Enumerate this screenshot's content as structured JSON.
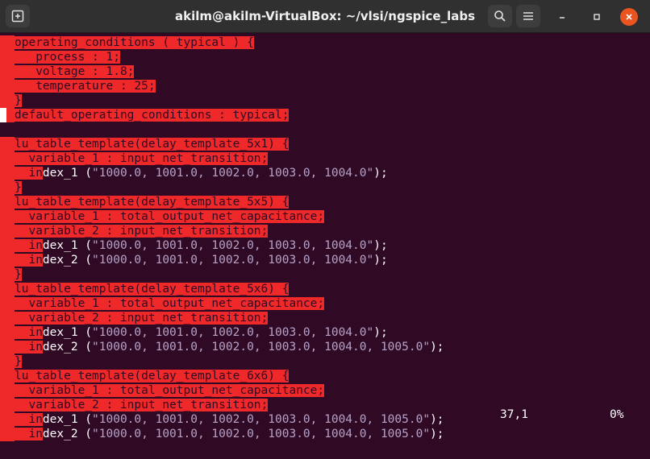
{
  "window": {
    "title": "akilm@akilm-VirtualBox: ~/vlsi/ngspice_labs"
  },
  "buffer": {
    "lines": [
      "operating_conditions ( typical ) {",
      "   process : 1;",
      "   voltage : 1.8;",
      "   temperature : 25;",
      "}",
      "default_operating_conditions : typical;",
      "",
      "lu_table_template(delay_template_5x1) {",
      "  variable_1 : input_net_transition;",
      "  index_1 (\"1000.0, 1001.0, 1002.0, 1003.0, 1004.0\");",
      "}",
      "lu_table_template(delay_template_5x5) {",
      "  variable_1 : total_output_net_capacitance;",
      "  variable_2 : input_net_transition;",
      "  index_1 (\"1000.0, 1001.0, 1002.0, 1003.0, 1004.0\");",
      "  index_2 (\"1000.0, 1001.0, 1002.0, 1003.0, 1004.0\");",
      "}",
      "lu_table_template(delay_template_5x6) {",
      "  variable_1 : total_output_net_capacitance;",
      "  variable_2 : input_net_transition;",
      "  index_1 (\"1000.0, 1001.0, 1002.0, 1003.0, 1004.0\");",
      "  index_2 (\"1000.0, 1001.0, 1002.0, 1003.0, 1004.0, 1005.0\");",
      "}",
      "lu_table_template(delay_template_6x6) {",
      "  variable_1 : total_output_net_capacitance;",
      "  variable_2 : input_net_transition;",
      "  index_1 (\"1000.0, 1001.0, 1002.0, 1003.0, 1004.0, 1005.0\");",
      "  index_2 (\"1000.0, 1001.0, 1002.0, 1003.0, 1004.0, 1005.0\");"
    ]
  },
  "status": {
    "position": "37,1",
    "percent": "0%"
  },
  "colors": {
    "background": "#300a24",
    "highlight": "#ef2929",
    "string": "#b6a2c8"
  }
}
